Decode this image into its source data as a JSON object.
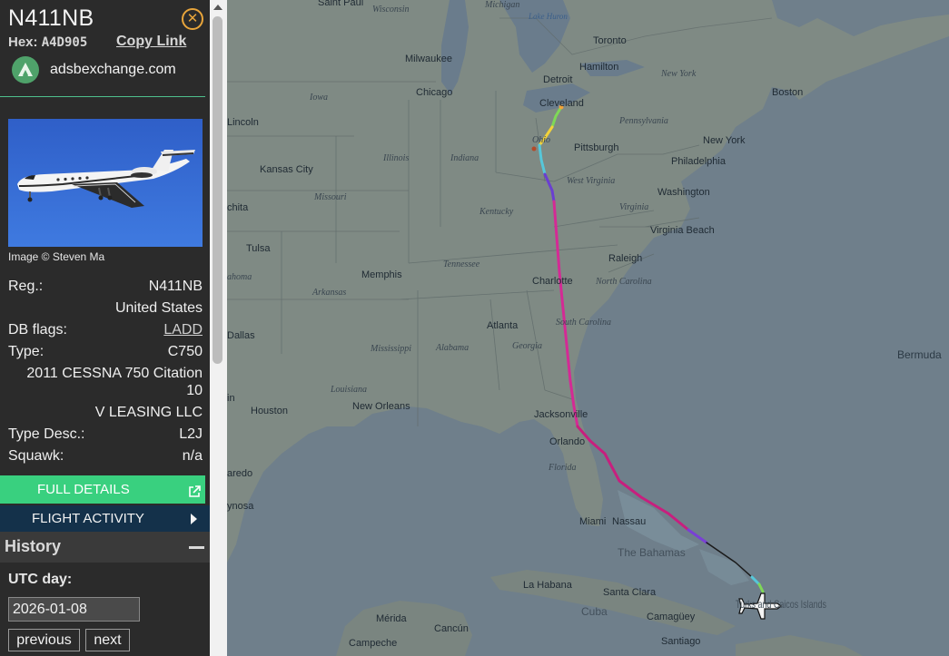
{
  "aircraft": {
    "registration_title": "N411NB",
    "hex_label": "Hex:",
    "hex_value": "A4D905",
    "copy_link_label": "Copy Link",
    "source_name": "adsbexchange.com",
    "photo_credit": "Image © Steven Ma"
  },
  "details": {
    "reg_label": "Reg.:",
    "reg_value": "N411NB",
    "country": "United States",
    "db_flags_label": "DB flags:",
    "db_flags_value": "LADD",
    "type_label": "Type:",
    "type_value": "C750",
    "model_line1": "2011 CESSNA 750 Citation",
    "model_line2": "10",
    "owner": "V LEASING LLC",
    "type_desc_label": "Type Desc.:",
    "type_desc_value": "L2J",
    "squawk_label": "Squawk:",
    "squawk_value": "n/a"
  },
  "buttons": {
    "full_details": "FULL DETAILS",
    "flight_activity": "FLIGHT ACTIVITY"
  },
  "history": {
    "title": "History",
    "utc_day_label": "UTC day:",
    "date_value": "2026-01-08",
    "previous_label": "previous",
    "next_label": "next"
  },
  "map": {
    "cities": {
      "saint_paul": "Saint Paul",
      "toronto": "Toronto",
      "milwaukee": "Milwaukee",
      "hamilton": "Hamilton",
      "new_york_state": "New York",
      "detroit": "Detroit",
      "chicago": "Chicago",
      "cleveland": "Cleveland",
      "boston": "Boston",
      "lincoln": "Lincoln",
      "new_york": "New York",
      "pittsburgh": "Pittsburgh",
      "kansas_city": "Kansas City",
      "philadelphia": "Philadelphia",
      "washington": "Washington",
      "wichita": "chita",
      "virginia_beach": "Virginia Beach",
      "tulsa": "Tulsa",
      "raleigh": "Raleigh",
      "memphis": "Memphis",
      "charlotte": "Charlotte",
      "atlanta": "Atlanta",
      "dallas": "Dallas",
      "bermuda": "Bermuda",
      "austin": "in",
      "houston": "Houston",
      "new_orleans": "New Orleans",
      "jacksonville": "Jacksonville",
      "orlando": "Orlando",
      "laredo": "aredo",
      "miami": "Miami",
      "nassau": "Nassau",
      "reynosa": "ynosa",
      "la_habana": "La Habana",
      "santa_clara": "Santa Clara",
      "turks_caicos": "Turks and Caicos Islands",
      "merida": "Mérida",
      "cancun": "Cancún",
      "camaguey": "Camagüey",
      "campeche": "Campeche",
      "santiago": "Santiago",
      "cuba": "Cuba",
      "the_bahamas": "The Bahamas"
    },
    "states": {
      "wisconsin": "Wisconsin",
      "michigan": "Michigan",
      "iowa": "Iowa",
      "pennsylvania": "Pennsylvania",
      "ohio": "Ohio",
      "illinois": "Illinois",
      "indiana": "Indiana",
      "west_virginia": "West Virginia",
      "missouri": "Missouri",
      "kentucky": "Kentucky",
      "virginia": "Virginia",
      "oklahoma": "ahoma",
      "tennessee": "Tennessee",
      "north_carolina": "North Carolina",
      "arkansas": "Arkansas",
      "south_carolina": "South Carolina",
      "mississippi": "Mississippi",
      "alabama": "Alabama",
      "georgia": "Georgia",
      "louisiana": "Louisiana",
      "florida": "Florida",
      "lake_michigan": "Michigan",
      "lake_huron": "Lake Huron"
    },
    "track_colors": [
      "#f2a43a",
      "#7fd857",
      "#f2d23a",
      "#56c7d9",
      "#6a3fd1",
      "#d42a95",
      "#c71f7e",
      "#7a3fd6",
      "#000000"
    ]
  }
}
